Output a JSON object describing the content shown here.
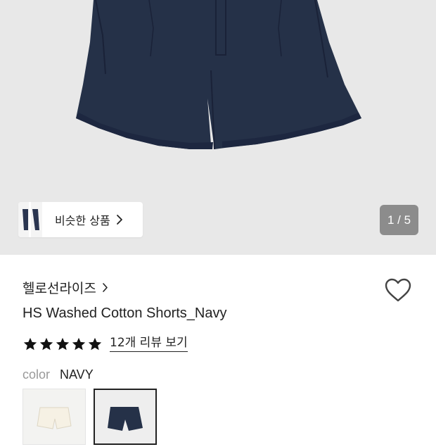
{
  "gallery": {
    "similar_label": "비슷한 상품",
    "counter": "1 / 5"
  },
  "product": {
    "brand": "헬로선라이즈",
    "name": "HS Washed Cotton Shorts_Navy",
    "rating_stars": 5,
    "reviews_link": "12개 리뷰 보기",
    "color_label": "color",
    "color_value": "NAVY"
  },
  "colors": {
    "navy": "#253148",
    "hero_bg": "#e8e8e8",
    "text": "#222222",
    "muted": "#999999"
  },
  "icons": [
    "chevron-right-icon",
    "heart-outline-icon",
    "star-icon"
  ]
}
